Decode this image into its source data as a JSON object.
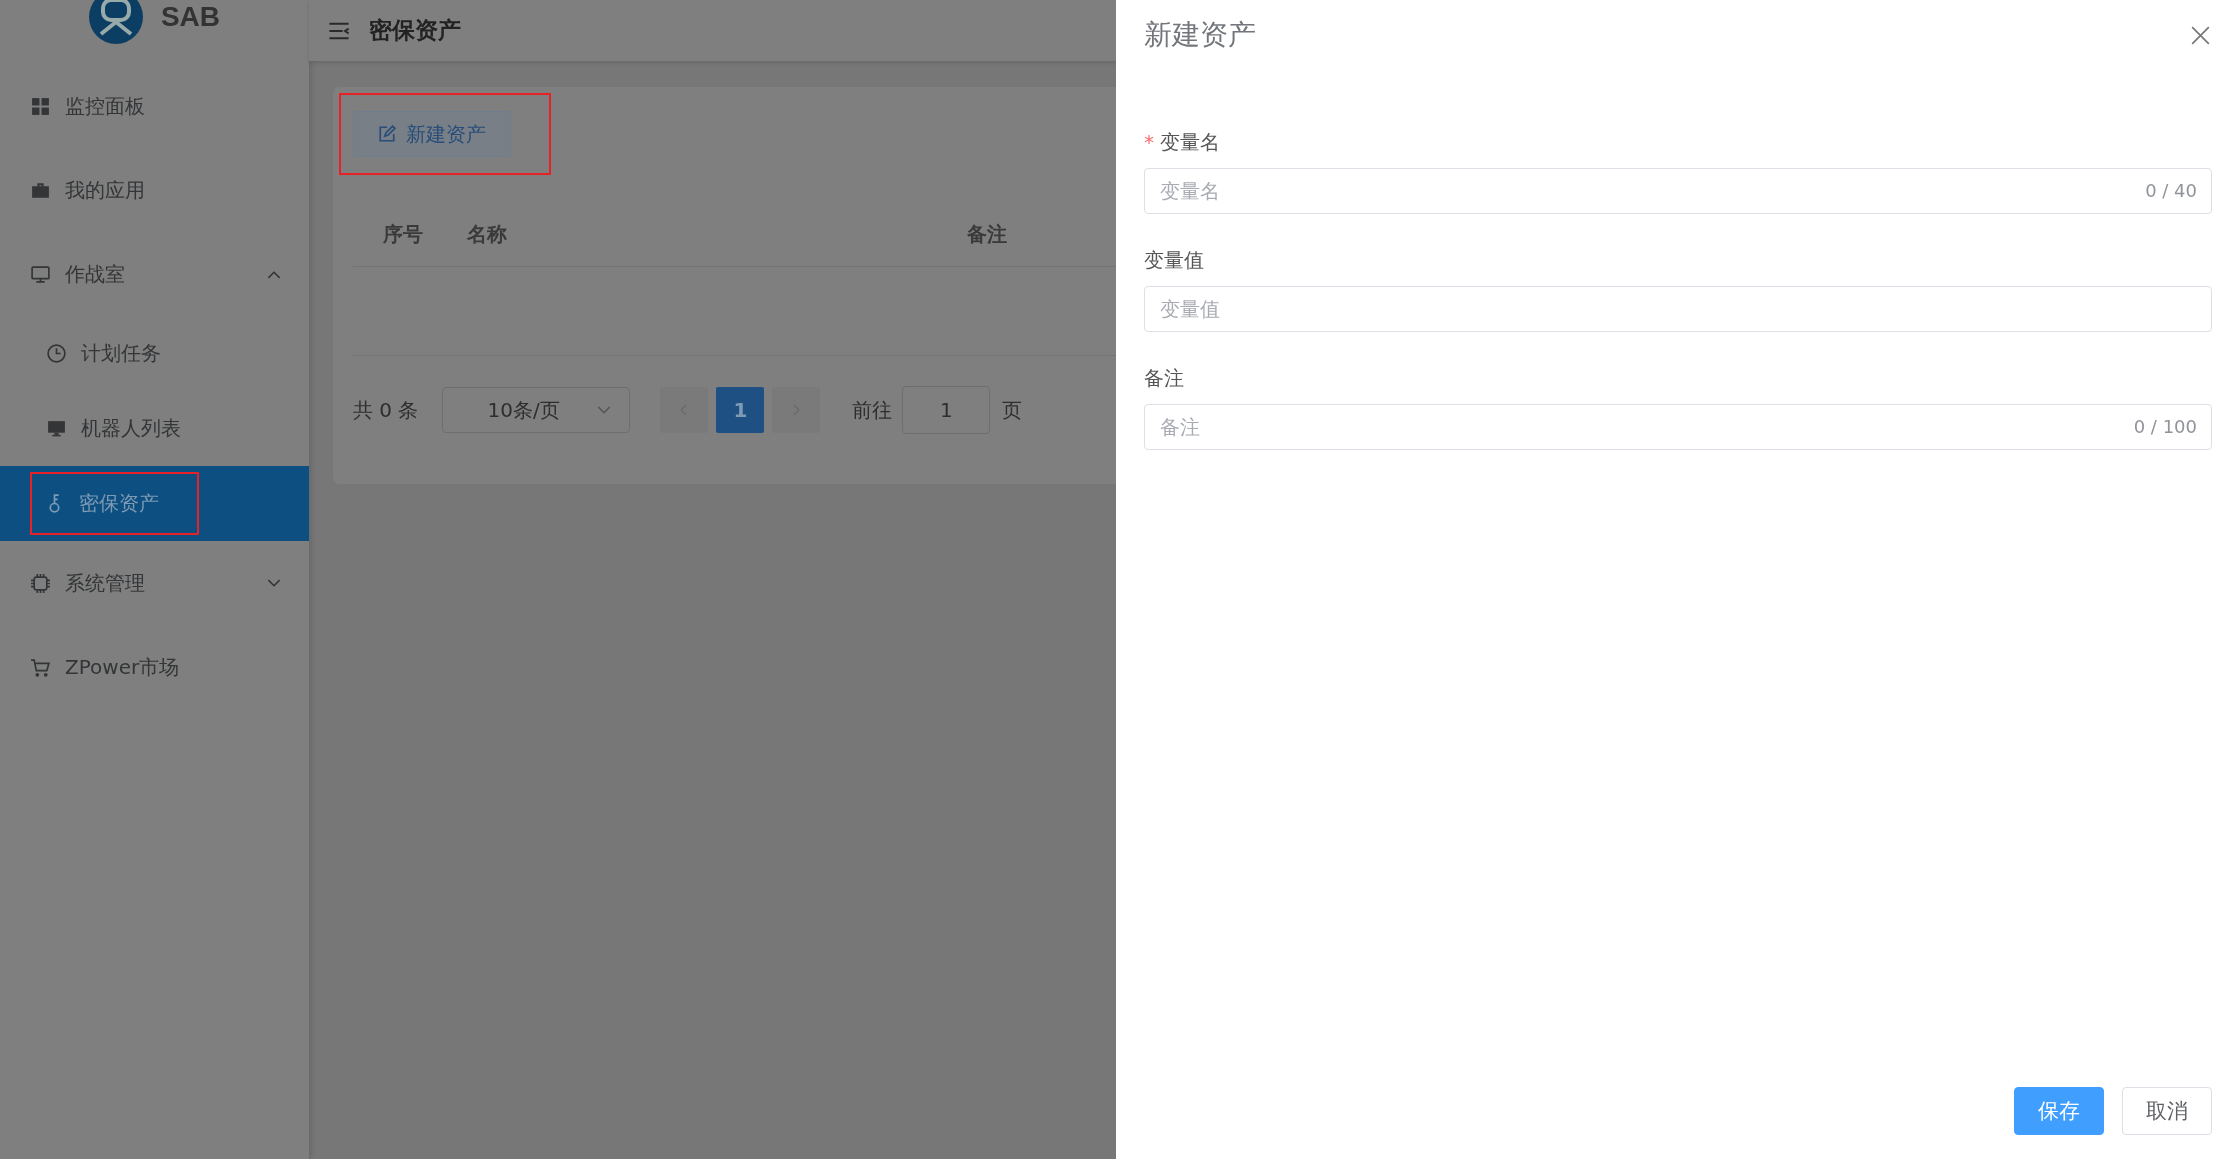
{
  "sidebar": {
    "logo_text": "SAB",
    "items": [
      {
        "label": "监控面板",
        "kind": "grid",
        "selected": false,
        "annotated": false
      },
      {
        "label": "我的应用",
        "kind": "briefcase",
        "selected": false,
        "annotated": false
      },
      {
        "label": "作战室",
        "kind": "monitor",
        "selected": false,
        "annotated": false,
        "expanded": true,
        "children": [
          {
            "label": "计划任务",
            "kind": "clock",
            "selected": false,
            "annotated": false
          },
          {
            "label": "机器人列表",
            "kind": "desktop",
            "selected": false,
            "annotated": false
          },
          {
            "label": "密保资产",
            "kind": "key",
            "selected": true,
            "annotated": true
          }
        ]
      },
      {
        "label": "系统管理",
        "kind": "chip",
        "selected": false,
        "annotated": false,
        "expanded": false
      },
      {
        "label": "ZPower市场",
        "kind": "cart",
        "selected": false,
        "annotated": false
      }
    ]
  },
  "header": {
    "title": "密保资产"
  },
  "toolbar": {
    "new_button": {
      "label": "新建资产",
      "annotated": true
    }
  },
  "table": {
    "columns": [
      "序号",
      "名称",
      "备注"
    ]
  },
  "pagination": {
    "total": "共 0 条",
    "page_size": "10条/页",
    "pages": [
      {
        "label": "1",
        "selected": true
      }
    ],
    "goto_label": "前往",
    "goto_value": "1",
    "page_suffix": "页"
  },
  "drawer": {
    "title": "新建资产",
    "fields": [
      {
        "required_mark": "*",
        "label": "变量名",
        "placeholder": "变量名",
        "counter": "0 / 40"
      },
      {
        "label": "变量值",
        "placeholder": "变量值"
      },
      {
        "label": "备注",
        "placeholder": "备注",
        "counter": "0 / 100"
      }
    ],
    "buttons": [
      {
        "label": "保存",
        "kind": "primary"
      },
      {
        "label": "取消",
        "kind": "default"
      }
    ]
  }
}
